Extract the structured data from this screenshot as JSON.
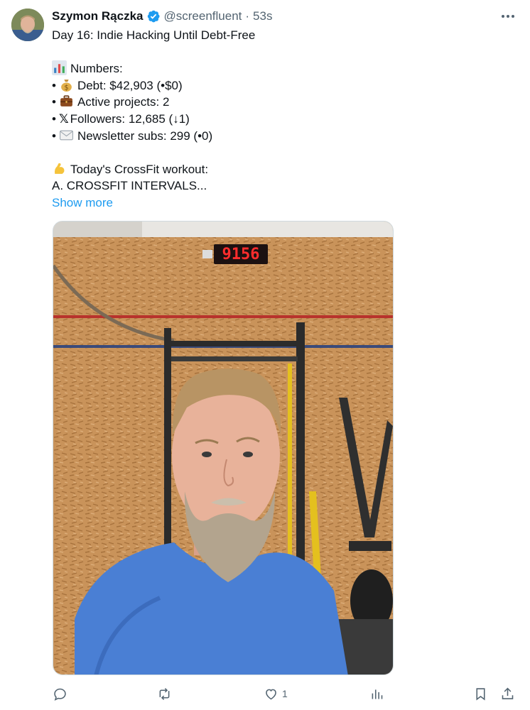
{
  "post": {
    "author": {
      "display_name": "Szymon Rączka",
      "verified": true,
      "handle": "@screenfluent",
      "separator": "·",
      "time": "53s"
    },
    "title_line": "Day 16: Indie Hacking Until Debt-Free",
    "numbers_heading": "Numbers:",
    "stats": [
      {
        "icon": "money-bag-icon",
        "text": "Debt: $42,903 (•$0)"
      },
      {
        "icon": "briefcase-icon",
        "text": "Active projects: 2"
      },
      {
        "icon": "x-logo-icon",
        "glyph": "𝕏",
        "text": "Followers: 12,685 (↓1)"
      },
      {
        "icon": "envelope-icon",
        "text": "Newsletter subs: 299 (•0)"
      }
    ],
    "bullet": "•",
    "workout_heading": "Today's CrossFit workout:",
    "workout_line": "A. CROSSFIT INTERVALS...",
    "show_more": "Show more",
    "media": {
      "clock_display": "9156",
      "description_icon": "photo"
    },
    "actions": {
      "reply_count": "",
      "repost_count": "",
      "like_count": "1",
      "views_count": ""
    }
  },
  "colors": {
    "link": "#1d9bf0",
    "secondary_text": "#536471",
    "verified": "#1d9bf0"
  }
}
